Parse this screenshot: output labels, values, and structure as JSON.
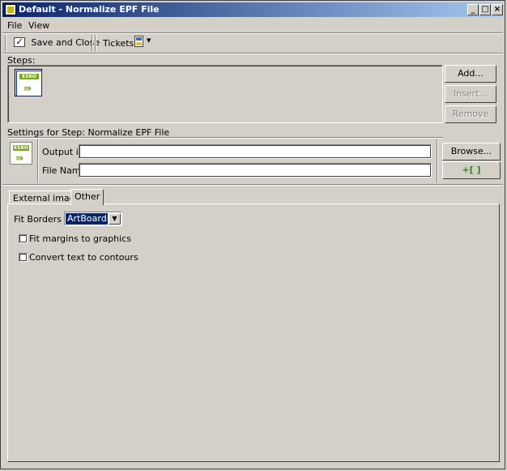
{
  "window": {
    "title": "Default - Normalize EPF File"
  },
  "menu": [
    "File",
    "View"
  ],
  "toolbar": {
    "save_close": "Save and Close",
    "tickets": "Tickets:"
  },
  "steps": {
    "label": "Steps:",
    "add": "Add...",
    "insert": "Insert...",
    "remove": "Remove",
    "badge": "ESKO"
  },
  "settings": {
    "header": "Settings for Step: Normalize EPF File",
    "output_label": "Output in:",
    "output_value": "",
    "filename_label": "File Name:",
    "filename_value": "",
    "browse": "Browse...",
    "plus": "+[ ]"
  },
  "tabs": [
    "External images",
    "Other"
  ],
  "other": {
    "fit_borders_label": "Fit Borders to",
    "fit_borders_value": "ArtBoard",
    "fit_margins": "Fit margins to graphics",
    "fit_margins_checked": false,
    "convert_text": "Convert text to contours",
    "convert_text_checked": false
  }
}
